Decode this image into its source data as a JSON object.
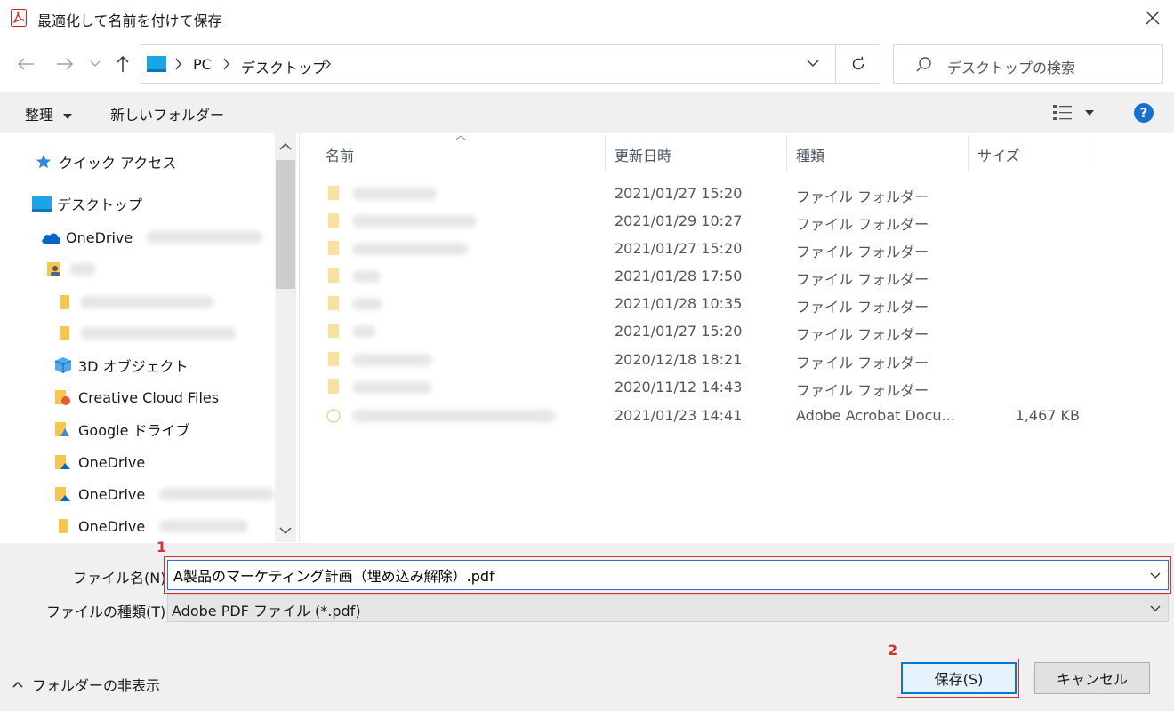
{
  "window": {
    "title": "最適化して名前を付けて保存"
  },
  "address": {
    "crumbs": [
      "PC",
      "デスクトップ"
    ]
  },
  "search": {
    "placeholder": "デスクトップの検索"
  },
  "toolbar": {
    "organize_label": "整理",
    "new_folder_label": "新しいフォルダー"
  },
  "nav": {
    "quick_access": "クイック アクセス",
    "desktop": "デスクトップ",
    "onedrive1": "OneDrive",
    "objects3d": "3D オブジェクト",
    "creative_cloud": "Creative Cloud Files",
    "google_drive": "Google ドライブ",
    "onedrive2": "OneDrive",
    "onedrive3": "OneDrive",
    "onedrive4": "OneDrive"
  },
  "list": {
    "columns": {
      "name": "名前",
      "date": "更新日時",
      "type": "種類",
      "size": "サイズ"
    },
    "rows": [
      {
        "date": "2021/01/27 15:20",
        "type": "ファイル フォルダー",
        "size": ""
      },
      {
        "date": "2021/01/29 10:27",
        "type": "ファイル フォルダー",
        "size": ""
      },
      {
        "date": "2021/01/27 15:20",
        "type": "ファイル フォルダー",
        "size": ""
      },
      {
        "date": "2021/01/28 17:50",
        "type": "ファイル フォルダー",
        "size": ""
      },
      {
        "date": "2021/01/28 10:35",
        "type": "ファイル フォルダー",
        "size": ""
      },
      {
        "date": "2021/01/27 15:20",
        "type": "ファイル フォルダー",
        "size": ""
      },
      {
        "date": "2020/12/18 18:21",
        "type": "ファイル フォルダー",
        "size": ""
      },
      {
        "date": "2020/11/12 14:43",
        "type": "ファイル フォルダー",
        "size": ""
      },
      {
        "date": "2021/01/23 14:41",
        "type": "Adobe Acrobat Docu...",
        "size": "1,467 KB"
      }
    ]
  },
  "form": {
    "filename_label": "ファイル名(N):",
    "filename_value": "A製品のマーケティング計画（埋め込み解除）.pdf",
    "filetype_label": "ファイルの種類(T):",
    "filetype_value": "Adobe PDF ファイル (*.pdf)"
  },
  "annotations": {
    "n1": "1",
    "n2": "2"
  },
  "buttons": {
    "save": "保存(S)",
    "cancel": "キャンセル",
    "hide_folders": "フォルダーの非表示"
  },
  "colors": {
    "accent": "#0078d7",
    "annotation": "#d23232",
    "folder": "#f5c84c"
  }
}
